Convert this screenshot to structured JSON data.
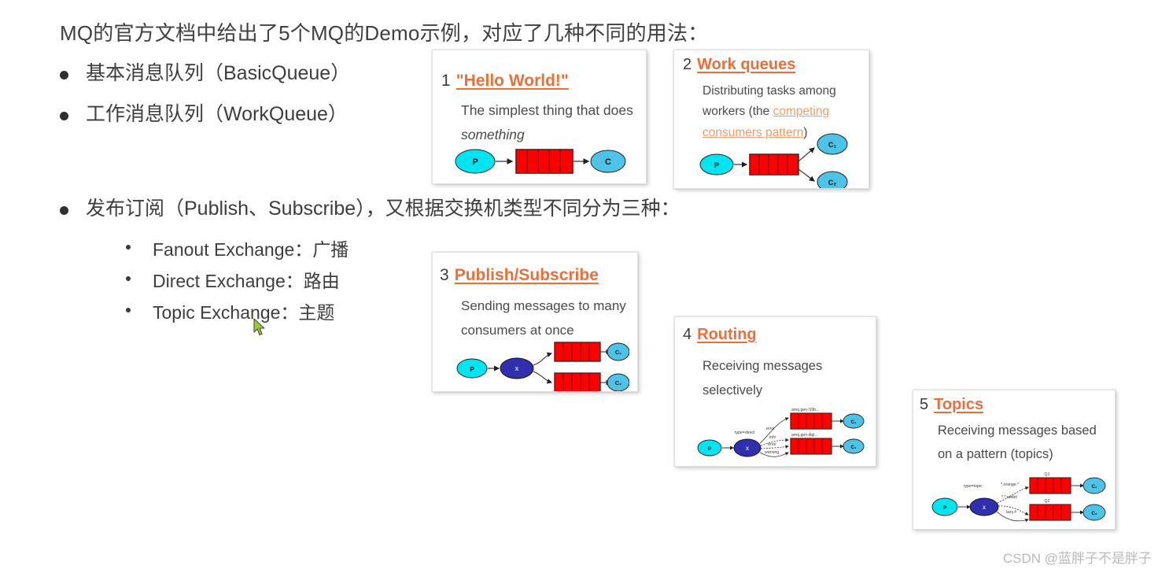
{
  "slide": {
    "title": "MQ的官方文档中给出了5个MQ的Demo示例，对应了几种不同的用法：",
    "bullets": [
      {
        "text": "基本消息队列（BasicQueue）"
      },
      {
        "text": "工作消息队列（WorkQueue）"
      },
      {
        "text": "发布订阅（Publish、Subscribe），又根据交换机类型不同分为三种："
      }
    ],
    "sub_bullets": [
      {
        "text": "Fanout Exchange：广播"
      },
      {
        "text": "Direct Exchange：路由"
      },
      {
        "text": "Topic Exchange：主题"
      }
    ]
  },
  "cards": {
    "hello": {
      "number": "1",
      "title": "\"Hello World!\"",
      "desc_plain": "The simplest thing that does ",
      "desc_italic": "something",
      "diagram": {
        "producer": "P",
        "consumer": "C"
      }
    },
    "work": {
      "number": "2",
      "title": "Work queues",
      "desc_part1": "Distributing tasks among workers (the ",
      "desc_link": "competing consumers pattern",
      "desc_part2": ")",
      "diagram": {
        "producer": "P",
        "consumer1": "C₁",
        "consumer2": "C₂"
      }
    },
    "pubsub": {
      "number": "3",
      "title": "Publish/Subscribe",
      "desc": "Sending messages to many consumers at once",
      "diagram": {
        "producer": "P",
        "exchange": "X",
        "consumer1": "C₁",
        "consumer2": "C₂"
      }
    },
    "routing": {
      "number": "4",
      "title": "Routing",
      "desc": "Receiving messages selectively",
      "diagram": {
        "producer": "P",
        "exchange": "X",
        "exchange_type": "type=direct",
        "binding_error": "error",
        "binding_info": "info",
        "binding_error2": "error",
        "binding_warning": "warning",
        "queue1": "amq.gen-S9b...",
        "queue2": "amq.gen-Agl...",
        "consumer1": "C₁",
        "consumer2": "C₂"
      }
    },
    "topics": {
      "number": "5",
      "title": "Topics",
      "desc": "Receiving messages based on a pattern (topics)",
      "diagram": {
        "producer": "P",
        "exchange": "X",
        "exchange_type": "type=topic",
        "binding1": "*.orange.*",
        "binding2": "*.*.rabbit",
        "binding3": "lazy.#",
        "queue1": "Q1",
        "queue2": "Q2",
        "consumer1": "C₁",
        "consumer2": "C₂"
      }
    }
  },
  "watermark": "CSDN @蓝胖子不是胖子",
  "colors": {
    "accent_orange": "#e8703a",
    "link_orange": "#e8a06a",
    "producer_cyan": "#00e5f0",
    "consumer_blue": "#4dc3e8",
    "queue_red": "#ff0000",
    "exchange_blue": "#2f2fb0",
    "text_gray": "#3d3d3d",
    "watermark_gray": "#b9b9b9"
  }
}
